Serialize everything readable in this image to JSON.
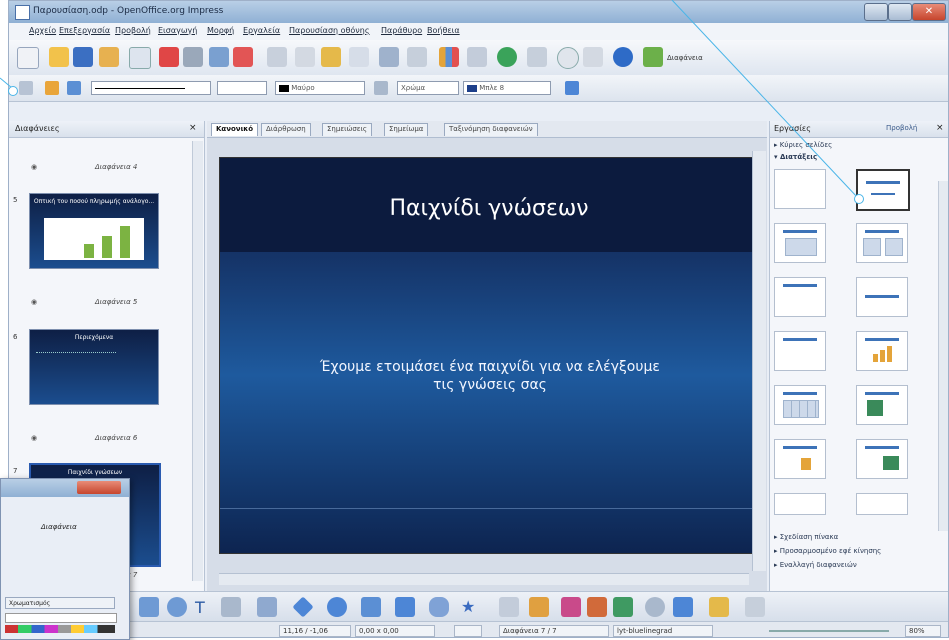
{
  "window": {
    "title": "Παρουσίαση.odp - OpenOffice.org Impress"
  },
  "menubar": {
    "items": [
      "Αρχείο",
      "Επεξεργασία",
      "Προβολή",
      "Εισαγωγή",
      "Μορφή",
      "Εργαλεία",
      "Παρουσίαση οθόνης",
      "Παράθυρο",
      "Βοήθεια"
    ]
  },
  "toolbar": {
    "line_color_label": "Μαύρο",
    "area_label": "Χρώμα",
    "area_color_label": "Μπλε 8",
    "layout_label": "Διαφάνεια"
  },
  "slides_panel": {
    "header": "Διαφάνειες",
    "close": "×",
    "slides": [
      {
        "num": "",
        "label": "Διαφάνεια 4",
        "title": ""
      },
      {
        "num": "5",
        "label": "Διαφάνεια 5",
        "title": "Οπτική του ποσού πληρωμής ανάλογο..."
      },
      {
        "num": "6",
        "label": "Διαφάνεια 6",
        "title": "Περιεχόμενα"
      },
      {
        "num": "7",
        "label": "Διαφάνεια 7",
        "title": "Παιχνίδι γνώσεων"
      }
    ]
  },
  "tabs": [
    "Κανονικό",
    "Διάρθρωση",
    "Σημειώσεις",
    "Σημείωμα",
    "Ταξινόμηση διαφανειών"
  ],
  "slide": {
    "title": "Παιχνίδι γνώσεων",
    "body_line1": "Έχουμε ετοιμάσει ένα παιχνίδι για να ελέγξουμε",
    "body_line2": "τις γνώσεις σας"
  },
  "tasks_panel": {
    "header": "Εργασίες",
    "view_label": "Προβολή",
    "sections": {
      "master": "Κύριες σελίδες",
      "layouts": "Διατάξεις",
      "table_design": "Σχεδίαση πίνακα",
      "custom_animation": "Προσαρμοσμένο εφέ κίνησης",
      "slide_transition": "Εναλλαγή διαφανειών"
    }
  },
  "statusbar": {
    "position": "11,16 / -1,06",
    "size": "0,00 x 0,00",
    "slide": "Διαφάνεια 7 / 7",
    "master": "lyt-bluelinegrad",
    "zoom": "80%"
  },
  "popup": {
    "label": "Διαφάνεια",
    "section": "Χρωματισμός"
  },
  "colors": {
    "accent": "#4ab5e8",
    "slide_dark": "#0c1b3e",
    "slide_blue": "#1e5a9e"
  }
}
